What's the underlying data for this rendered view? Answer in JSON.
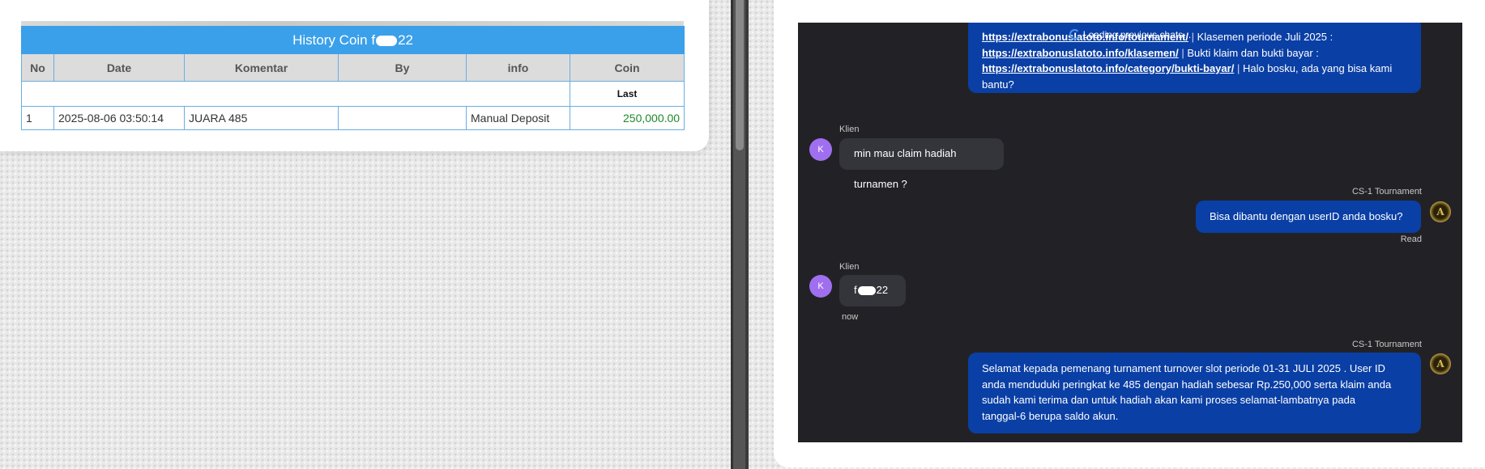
{
  "history": {
    "title_prefix": "History Coin f",
    "title_suffix": "22",
    "columns": [
      "No",
      "Date",
      "Komentar",
      "By",
      "info",
      "Coin"
    ],
    "last_label": "Last",
    "rows": [
      {
        "no": "1",
        "date": "2025-08-06 03:50:14",
        "komentar": "JUARA 485",
        "by": "",
        "info": "Manual Deposit",
        "coin": "250,000.00"
      }
    ]
  },
  "chat": {
    "loading_text": "Loading previous chats...",
    "first_message": {
      "line1_link": "https://extrabonuslatoto.info/tournament/",
      "line1_text": "Klasemen periode Juli 2025 :",
      "line2_link": "https://extrabonuslatoto.info/klasemen/",
      "line2_text": "Bukti klaim dan bukti bayar :",
      "line3_link": "https://extrabonuslatoto.info/category/bukti-bayar/",
      "line3_text": "Halo bosku, ada yang bisa kami",
      "line4_text": "bantu?"
    },
    "messages": [
      {
        "sender": "Klien",
        "avatar": "K",
        "text": "min mau claim hadiah turnamen ?"
      },
      {
        "sender": "CS-1 Tournament",
        "avatar": "A",
        "text": "Bisa dibantu dengan userID anda bosku?",
        "status": "Read"
      },
      {
        "sender": "Klien",
        "avatar": "K",
        "text_prefix": "f",
        "text_suffix": "22",
        "time": "now"
      },
      {
        "sender": "CS-1 Tournament",
        "avatar": "A",
        "lines": [
          "Selamat kepada pemenang turnament turnover slot periode 01-31 JULI 2025 . User ID",
          "anda menduduki peringkat ke 485 dengan hadiah sebesar Rp.250,000 serta klaim anda",
          "sudah kami terima dan untuk hadiah akan kami proses selamat-lambatnya pada",
          "tanggal-6 berupa saldo akun."
        ]
      }
    ]
  },
  "colors": {
    "table_header_blue": "#3ba0ea",
    "coin_green": "#1d8a2c",
    "outgoing_bubble": "#0a3fa5",
    "incoming_bubble": "#34353b",
    "chat_bg": "#222226",
    "client_avatar": "#a06ff0"
  }
}
